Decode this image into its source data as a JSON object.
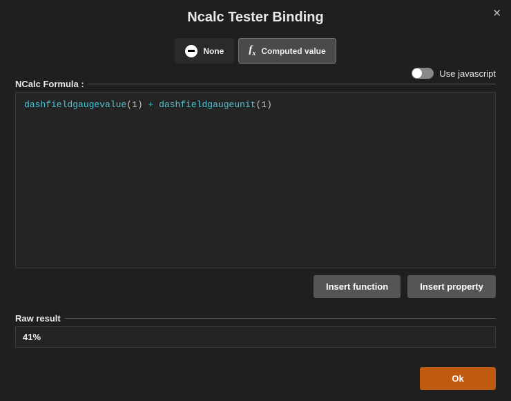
{
  "title": "Ncalc Tester Binding",
  "tabs": {
    "none": "None",
    "computed": "Computed value"
  },
  "toggle_label": "Use javascript",
  "formula_label": "NCalc Formula :",
  "formula_tokens": {
    "fn1": "dashfieldgaugevalue",
    "lp": "(",
    "n": "1",
    "rp": ")",
    "op": " + ",
    "fn2": "dashfieldgaugeunit"
  },
  "buttons": {
    "insert_function": "Insert function",
    "insert_property": "Insert property",
    "ok": "Ok"
  },
  "raw_label": "Raw result",
  "raw_value": "41%"
}
